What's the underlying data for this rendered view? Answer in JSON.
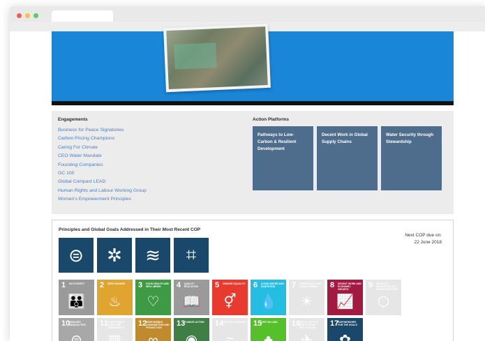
{
  "engagements": {
    "heading": "Engagements",
    "items": [
      "Business for Peace Signatories",
      "Carbon Pricing Champions",
      "Caring For Climate",
      "CEO Water Mandate",
      "Founding Companies",
      "GC 100",
      "Global Compact LEAD",
      "Human Rights and Labour Working Group",
      "Women's Empowerment Principles"
    ]
  },
  "action_platforms": {
    "heading": "Action Platforms",
    "items": [
      "Pathways to Low-Carbon & Resilient Development",
      "Decent Work in Global Supply Chains",
      "Water Security through Stewardship"
    ]
  },
  "goals": {
    "heading": "Principles and Global Goals Addressed in Their Most Recent COP",
    "next_cop_label": "Next COP due on:",
    "next_cop_date": "22 June 2018",
    "principle_icons": [
      "equality-icon",
      "compass-icon",
      "waves-icon",
      "crop-icon"
    ],
    "sdg_row1": [
      {
        "num": "1",
        "label": "No poverty",
        "color": "#9a9a9a",
        "glyph": "👪",
        "icon": "family-icon",
        "faded": false
      },
      {
        "num": "2",
        "label": "Zero hunger",
        "color": "#e0a52f",
        "glyph": "♨",
        "icon": "bowl-icon",
        "faded": false
      },
      {
        "num": "3",
        "label": "Good health and well-being",
        "color": "#3f9a45",
        "glyph": "♡",
        "icon": "heartbeat-icon",
        "faded": false
      },
      {
        "num": "4",
        "label": "Quality education",
        "color": "#9a9a9a",
        "glyph": "📖",
        "icon": "book-icon",
        "faded": false
      },
      {
        "num": "5",
        "label": "Gender equality",
        "color": "#e93a2f",
        "glyph": "⚥",
        "icon": "gender-icon",
        "faded": false
      },
      {
        "num": "6",
        "label": "Clean water and sanitation",
        "color": "#26bde2",
        "glyph": "💧",
        "icon": "water-drop-icon",
        "faded": false
      },
      {
        "num": "7",
        "label": "Affordable and clean energy",
        "color": "#c8c8c8",
        "glyph": "☀",
        "icon": "sun-icon",
        "faded": true
      },
      {
        "num": "8",
        "label": "Decent work and economic growth",
        "color": "#a21942",
        "glyph": "📈",
        "icon": "growth-chart-icon",
        "faded": false
      },
      {
        "num": "9",
        "label": "Industry innovation and infrastructure",
        "color": "#c8c8c8",
        "glyph": "⬡",
        "icon": "cubes-icon",
        "faded": true
      }
    ],
    "sdg_row2": [
      {
        "num": "10",
        "label": "Reduced inequalities",
        "color": "#a8a8a8",
        "glyph": "⊜",
        "icon": "equals-icon",
        "faded": false
      },
      {
        "num": "11",
        "label": "Sustainable cities and communities",
        "color": "#c8c8c8",
        "glyph": "▥",
        "icon": "city-icon",
        "faded": true
      },
      {
        "num": "12",
        "label": "Responsible consumption and production",
        "color": "#bf8b2e",
        "glyph": "∞",
        "icon": "infinity-icon",
        "faded": false
      },
      {
        "num": "13",
        "label": "Climate action",
        "color": "#3f7e44",
        "glyph": "◉",
        "icon": "eye-globe-icon",
        "faded": false
      },
      {
        "num": "14",
        "label": "Life below water",
        "color": "#c8c8c8",
        "glyph": "≈",
        "icon": "fish-icon",
        "faded": true
      },
      {
        "num": "15",
        "label": "Life on land",
        "color": "#56c02b",
        "glyph": "♣",
        "icon": "tree-icon",
        "faded": false
      },
      {
        "num": "16",
        "label": "Peace justice and strong institutions",
        "color": "#c8c8c8",
        "glyph": "✈",
        "icon": "dove-icon",
        "faded": true
      },
      {
        "num": "17",
        "label": "Partnerships for the goals",
        "color": "#19486a",
        "glyph": "✿",
        "icon": "rings-icon",
        "faded": false
      }
    ]
  }
}
